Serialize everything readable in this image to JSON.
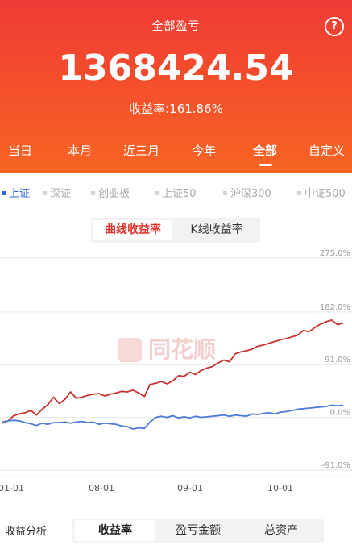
{
  "header": {
    "title": "全部盈亏",
    "help_icon": "?",
    "total_value": "1368424.54",
    "rate_label": "收益率:",
    "rate_value": "161.86%"
  },
  "periods": [
    {
      "label": "当日"
    },
    {
      "label": "本月"
    },
    {
      "label": "近三月"
    },
    {
      "label": "今年"
    },
    {
      "label": "全部",
      "active": true
    },
    {
      "label": "自定义"
    }
  ],
  "indices": [
    {
      "label": "上证",
      "active": true
    },
    {
      "label": "深证"
    },
    {
      "label": "创业板"
    },
    {
      "label": "上证50"
    },
    {
      "label": "沪深300"
    },
    {
      "label": "中证500"
    }
  ],
  "view_toggle": {
    "curve_label": "曲线收益率",
    "kline_label": "K线收益率"
  },
  "chart_data": {
    "type": "line",
    "x_ticks": [
      "01-01",
      "08-01",
      "09-01",
      "10-01"
    ],
    "y_ticks": [
      "275.0%",
      "182.0%",
      "91.0%",
      "0.0%",
      "-91.0%"
    ],
    "ylim": [
      -91,
      275
    ],
    "watermark": "同花顺",
    "series": [
      {
        "color": "#c8312f",
        "x": [
          0,
          1,
          2,
          3,
          4,
          5,
          6,
          7,
          8,
          9,
          10,
          11,
          12,
          13,
          14,
          15,
          16,
          17,
          18,
          19,
          20,
          21,
          22,
          23,
          24,
          25,
          26,
          27,
          28,
          29,
          30,
          31,
          32,
          33,
          34,
          35,
          36,
          37,
          38,
          39,
          40,
          41,
          42,
          43,
          44,
          45,
          46,
          47,
          48,
          49,
          50,
          51,
          52,
          53,
          54,
          55,
          56,
          57,
          58,
          59,
          60
        ],
        "y": [
          -10,
          -6,
          3,
          6,
          8,
          12,
          4,
          14,
          22,
          35,
          24,
          31,
          44,
          33,
          35,
          38,
          40,
          41,
          37,
          40,
          42,
          45,
          44,
          47,
          42,
          36,
          57,
          59,
          62,
          58,
          63,
          72,
          71,
          78,
          74,
          81,
          85,
          88,
          94,
          99,
          96,
          110,
          113,
          115,
          118,
          123,
          125,
          128,
          131,
          134,
          136,
          139,
          142,
          150,
          148,
          155,
          161,
          165,
          168,
          160,
          163
        ]
      },
      {
        "color": "#4a7ad6",
        "x": [
          0,
          1,
          2,
          3,
          4,
          5,
          6,
          7,
          8,
          9,
          10,
          11,
          12,
          13,
          14,
          15,
          16,
          17,
          18,
          19,
          20,
          21,
          22,
          23,
          24,
          25,
          26,
          27,
          28,
          29,
          30,
          31,
          32,
          33,
          34,
          35,
          36,
          37,
          38,
          39,
          40,
          41,
          42,
          43,
          44,
          45,
          46,
          47,
          48,
          49,
          50,
          51,
          52,
          53,
          54,
          55,
          56,
          57,
          58,
          59,
          60
        ],
        "y": [
          -8,
          -6,
          -5,
          -6,
          -9,
          -11,
          -14,
          -10,
          -12,
          -9,
          -9,
          -8,
          -10,
          -8,
          -7,
          -9,
          -8,
          -12,
          -10,
          -11,
          -12,
          -15,
          -16,
          -20,
          -18,
          -19,
          -8,
          0,
          2,
          0,
          3,
          -1,
          1,
          -1,
          2,
          0,
          1,
          2,
          3,
          4,
          2,
          4,
          3,
          2,
          6,
          5,
          7,
          8,
          6,
          9,
          10,
          12,
          14,
          15,
          16,
          17,
          18,
          19,
          21,
          20,
          21
        ]
      }
    ]
  },
  "bottom": {
    "section_label": "收益分析",
    "tabs": [
      {
        "label": "收益率",
        "active": true
      },
      {
        "label": "盈亏金额"
      },
      {
        "label": "总资产"
      }
    ]
  }
}
